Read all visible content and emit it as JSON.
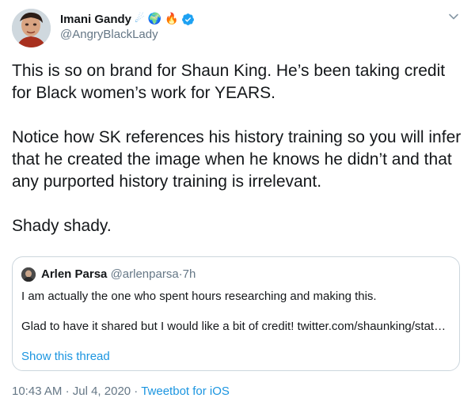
{
  "author": {
    "display_name": "Imani Gandy",
    "name_emojis": [
      "☄",
      "🌍",
      "🔥"
    ],
    "handle": "@AngryBlackLady",
    "verified": true
  },
  "tweet": {
    "paragraphs": [
      "This is so on brand for Shaun King. He’s been taking credit for Black women’s work for YEARS.",
      "Notice how SK references his history training so you will infer that he created the image when he knows he didn’t and that any purported history training is irrelevant.",
      "Shady shady."
    ]
  },
  "quoted": {
    "name": "Arlen Parsa",
    "handle": "@arlenparsa",
    "separator": "·",
    "time": "7h",
    "paragraphs": [
      "I am actually the one who spent hours researching and making this.",
      "Glad to have it shared but I would like a bit of credit! twitter.com/shaunking/stat…"
    ],
    "show_thread": "Show this thread"
  },
  "meta": {
    "time": "10:43 AM",
    "sep1": "·",
    "date": "Jul 4, 2020",
    "sep2": "·",
    "source": "Tweetbot for iOS"
  },
  "colors": {
    "link": "#1b95e0",
    "secondary_text": "#657786",
    "border": "#ccd6dd",
    "verified": "#1da1f2"
  },
  "icons": {
    "verified": "verified-badge-icon",
    "menu": "chevron-down-icon"
  }
}
